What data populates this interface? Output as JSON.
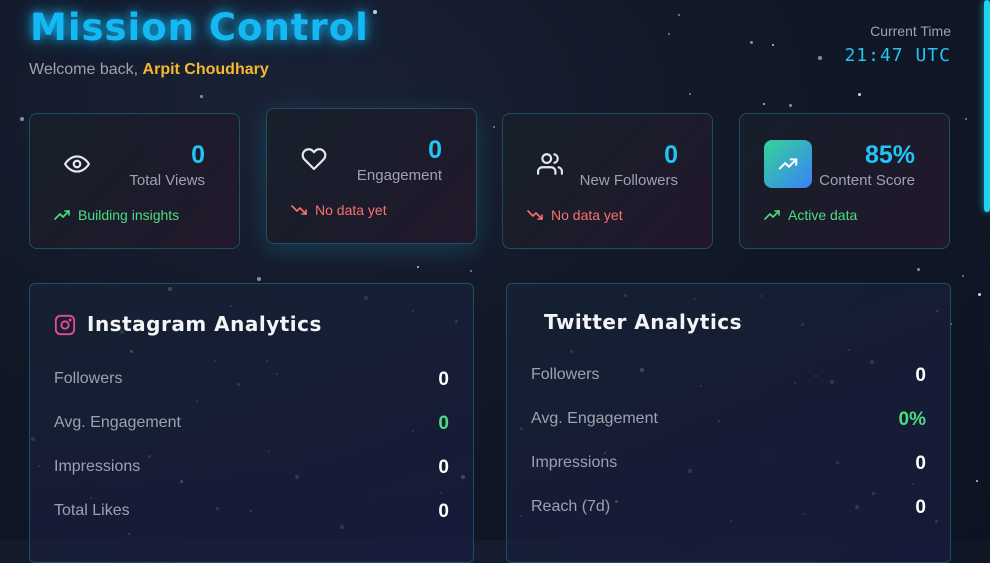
{
  "header": {
    "title": "Mission Control",
    "welcome_prefix": "Welcome back,",
    "user_name": "Arpit Choudhary",
    "time_label": "Current Time",
    "time_value": "21:47 UTC"
  },
  "stats": [
    {
      "icon": "eye-icon",
      "value": "0",
      "label": "Total Views",
      "trend": "Building insights",
      "trend_direction": "up"
    },
    {
      "icon": "heart-icon",
      "value": "0",
      "label": "Engagement",
      "trend": "No data yet",
      "trend_direction": "down"
    },
    {
      "icon": "users-icon",
      "value": "0",
      "label": "New Followers",
      "trend": "No data yet",
      "trend_direction": "down"
    },
    {
      "icon": "trending-up-icon",
      "value": "85%",
      "label": "Content Score",
      "trend": "Active data",
      "trend_direction": "up"
    }
  ],
  "instagram": {
    "title": "Instagram Analytics",
    "icon": "instagram-icon",
    "metrics": [
      {
        "label": "Followers",
        "value": "0"
      },
      {
        "label": "Avg. Engagement",
        "value": "0"
      },
      {
        "label": "Impressions",
        "value": "0"
      },
      {
        "label": "Total Likes",
        "value": "0"
      }
    ]
  },
  "twitter": {
    "title": "Twitter Analytics",
    "metrics": [
      {
        "label": "Followers",
        "value": "0"
      },
      {
        "label": "Avg. Engagement",
        "value": "0%"
      },
      {
        "label": "Impressions",
        "value": "0"
      },
      {
        "label": "Reach (7d)",
        "value": "0"
      }
    ]
  },
  "colors": {
    "accent": "#14b8f5",
    "user_name": "#f5b82e",
    "positive": "#4ade80",
    "negative": "#f87171",
    "instagram": "#ec4899"
  }
}
